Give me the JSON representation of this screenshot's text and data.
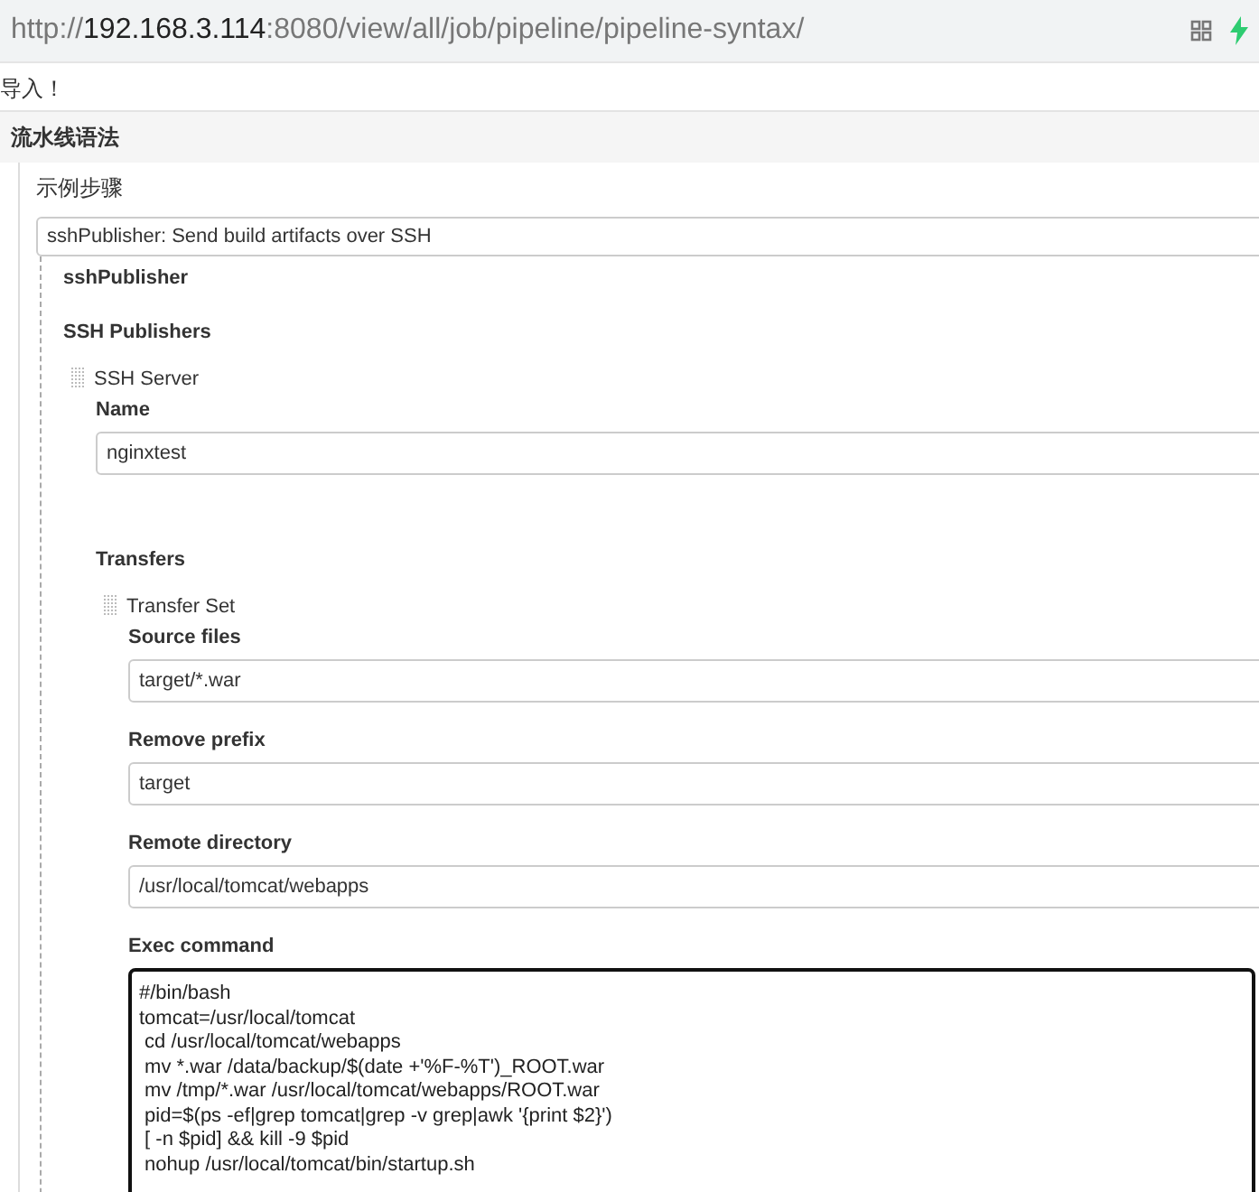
{
  "address_bar": {
    "scheme": "http://",
    "host": "192.168.3.114",
    "path": ":8080/view/all/job/pipeline/pipeline-syntax/"
  },
  "notice": "导入！",
  "section": {
    "title": "流水线语法"
  },
  "sample_step": {
    "label": "示例步骤",
    "value": "sshPublisher: Send build artifacts over SSH"
  },
  "step_title": "sshPublisher",
  "publishers_label": "SSH Publishers",
  "server": {
    "title": "SSH Server",
    "name_label": "Name",
    "name_value": "nginxtest"
  },
  "transfers_label": "Transfers",
  "transfer_set": {
    "title": "Transfer Set",
    "fields": [
      {
        "label": "Source files",
        "value": "target/*.war"
      },
      {
        "label": "Remove prefix",
        "value": "target"
      },
      {
        "label": "Remote directory",
        "value": "/usr/local/tomcat/webapps"
      }
    ],
    "exec": {
      "label": "Exec command",
      "value": "#/bin/bash\ntomcat=/usr/local/tomcat\n cd /usr/local/tomcat/webapps\n mv *.war /data/backup/$(date +'%F-%T')_ROOT.war\n mv /tmp/*.war /usr/local/tomcat/webapps/ROOT.war\n pid=$(ps -ef|grep tomcat|grep -v grep|awk '{print $2}')\n [ -n $pid] && kill -9 $pid\n nohup /usr/local/tomcat/bin/startup.sh"
    }
  }
}
